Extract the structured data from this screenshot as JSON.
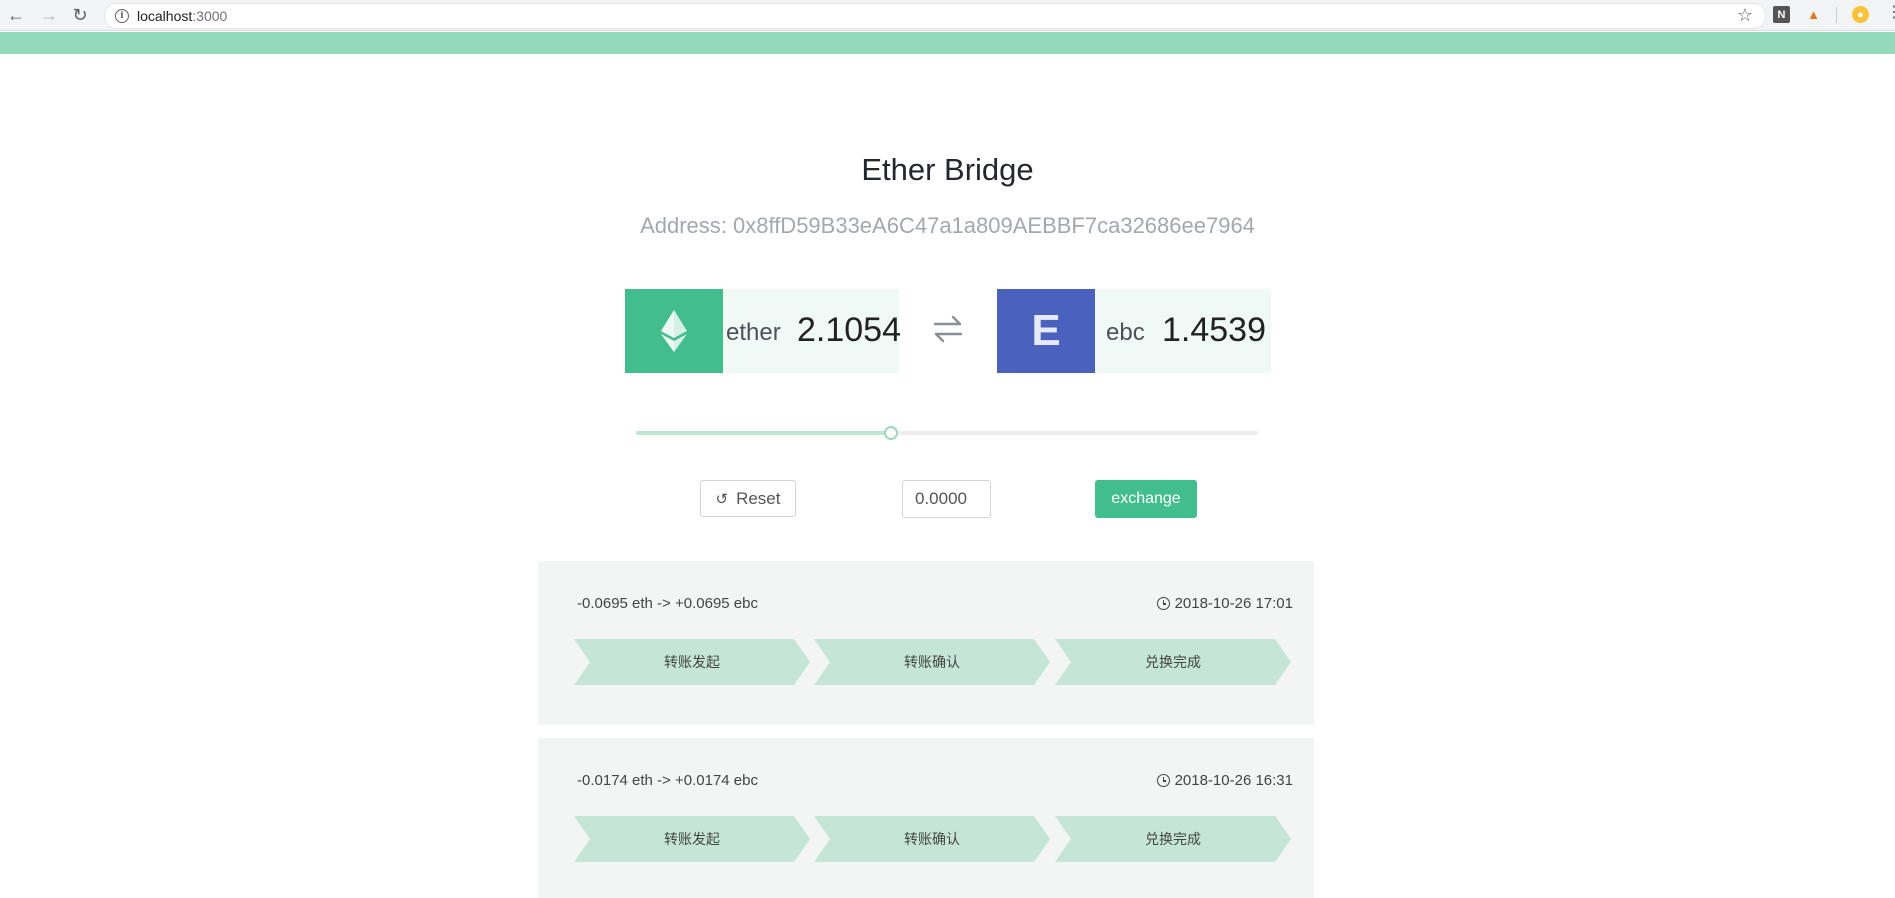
{
  "browser": {
    "url_host": "localhost",
    "url_port": ":3000"
  },
  "app": {
    "title": "Ether Bridge",
    "address": "Address: 0x8ffD59B33eA6C47a1a809AEBBF7ca32686ee7964",
    "accent_color": "#42bd8e",
    "ebc_color": "#4a61bd"
  },
  "tokens": {
    "ether": {
      "name": "ether",
      "amount": "2.1054",
      "icon": "ethereum-icon"
    },
    "ebc": {
      "name": "ebc",
      "amount": "1.4539",
      "icon_letter": "E"
    }
  },
  "slider": {
    "value_fraction": 0.41
  },
  "controls": {
    "reset_label": "Reset",
    "amount_value": "0.0000",
    "exchange_label": "exchange"
  },
  "records": [
    {
      "summary": "-0.0695 eth -> +0.0695 ebc",
      "time": "2018-10-26 17:01",
      "steps": [
        "转账发起",
        "转账确认",
        "兑换完成"
      ]
    },
    {
      "summary": "-0.0174 eth -> +0.0174 ebc",
      "time": "2018-10-26 16:31",
      "steps": [
        "转账发起",
        "转账确认",
        "兑换完成"
      ]
    }
  ]
}
